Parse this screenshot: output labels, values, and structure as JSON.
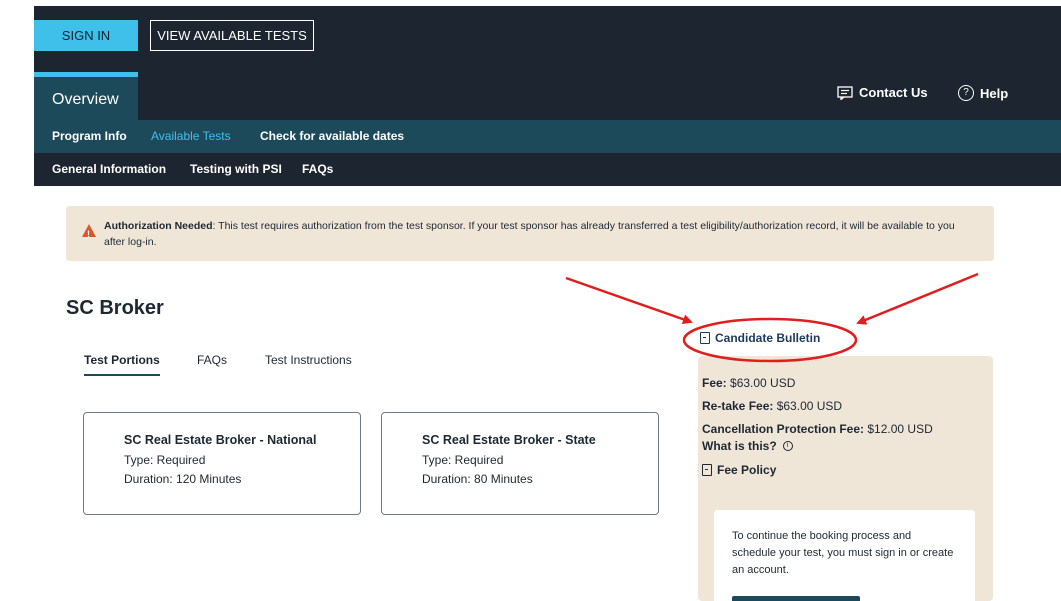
{
  "header": {
    "sign_in": "SIGN IN",
    "view_tests": "VIEW AVAILABLE TESTS",
    "overview": "Overview",
    "contact": "Contact Us",
    "help": "Help",
    "contact_icon": "chat-icon",
    "help_icon": "question-circle-icon"
  },
  "nav_primary": {
    "program_info": "Program Info",
    "available_tests": "Available Tests",
    "check_dates": "Check for available dates"
  },
  "nav_secondary": {
    "general_info": "General Information",
    "testing_psi": "Testing with PSI",
    "faqs": "FAQs"
  },
  "alert": {
    "title": "Authorization Needed",
    "message": ": This test requires authorization from the test sponsor. If your test sponsor has already transferred a test eligibility/authorization record, it will be available to you after log-in."
  },
  "page": {
    "title": "SC Broker"
  },
  "tabs": {
    "test_portions": "Test Portions",
    "faqs": "FAQs",
    "instructions": "Test Instructions"
  },
  "cards": [
    {
      "title": "SC Real Estate Broker - National",
      "type": "Type: Required",
      "duration": "Duration: 120 Minutes"
    },
    {
      "title": "SC Real Estate Broker - State",
      "type": "Type: Required",
      "duration": "Duration: 80 Minutes"
    }
  ],
  "sidebar": {
    "bulletin": "Candidate Bulletin",
    "fee_label": "Fee:",
    "fee_value": " $63.00 USD",
    "retake_label": "Re-take Fee:",
    "retake_value": " $63.00 USD",
    "cancel_label": "Cancellation Protection Fee:",
    "cancel_value": " $12.00 USD",
    "what_is_this": "What is this?",
    "info_icon_glyph": "i",
    "fee_policy": "Fee Policy",
    "signin_message": "To continue the booking process and schedule your test, you must sign in or create an account."
  },
  "colors": {
    "accent": "#3ec0ea",
    "teal": "#1c4a5a",
    "dark": "#1d2630",
    "beige": "#f0e6d8",
    "annotation": "#e01e1e"
  }
}
